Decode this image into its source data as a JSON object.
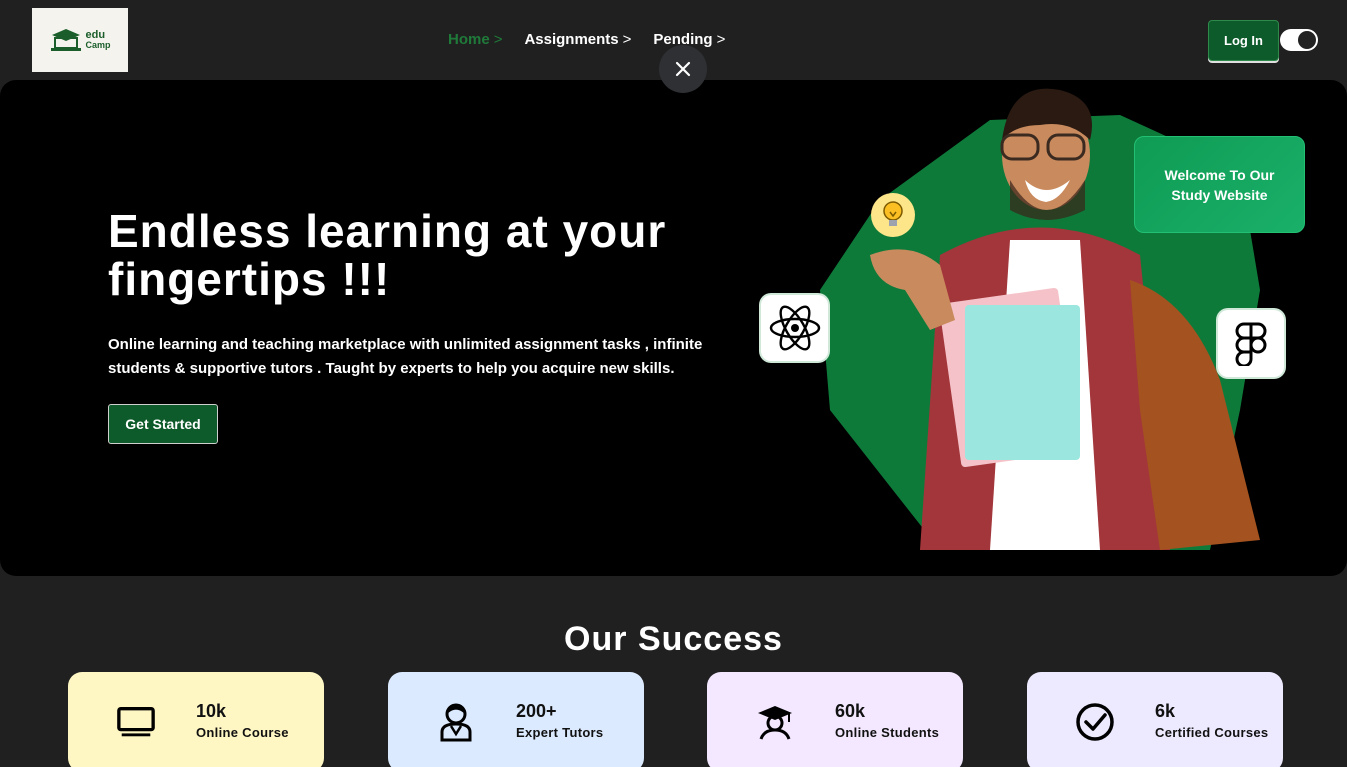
{
  "logo": {
    "line1": "edu",
    "line2": "Camp",
    "icon": "graduation-laptop-icon"
  },
  "nav": {
    "items": [
      {
        "label": "Home",
        "active": true
      },
      {
        "label": "Assignments",
        "active": false
      },
      {
        "label": "Pending",
        "active": false
      }
    ],
    "chevron": ">"
  },
  "header": {
    "login_label": "Log In",
    "theme_toggle": "dark",
    "close_icon": "close-icon"
  },
  "hero": {
    "title": "Endless learning at your fingertips !!!",
    "description": "Online learning and teaching marketplace with unlimited assignment tasks , infinite students & supportive tutors . Taught by experts to help you acquire new skills.",
    "cta_label": "Get Started",
    "welcome_card": "Welcome To Our Study Website",
    "icons": [
      "react-icon",
      "figma-icon",
      "lightbulb-icon"
    ]
  },
  "success": {
    "title": "Our Success",
    "stats": [
      {
        "value": "10k",
        "label": "Online Course",
        "icon": "monitor-icon",
        "bg": "#fef6c3"
      },
      {
        "value": "200+",
        "label": "Expert Tutors",
        "icon": "tutor-icon",
        "bg": "#dbeafe"
      },
      {
        "value": "60k",
        "label": "Online Students",
        "icon": "graduate-icon",
        "bg": "#f3e8ff"
      },
      {
        "value": "6k",
        "label": "Certified Courses",
        "icon": "check-circle-icon",
        "bg": "#ede9fe"
      }
    ]
  },
  "colors": {
    "brand_green": "#0d5a2a",
    "active_nav": "#1f7a3a",
    "hero_blob": "#0e7a3a",
    "background": "#202020"
  }
}
